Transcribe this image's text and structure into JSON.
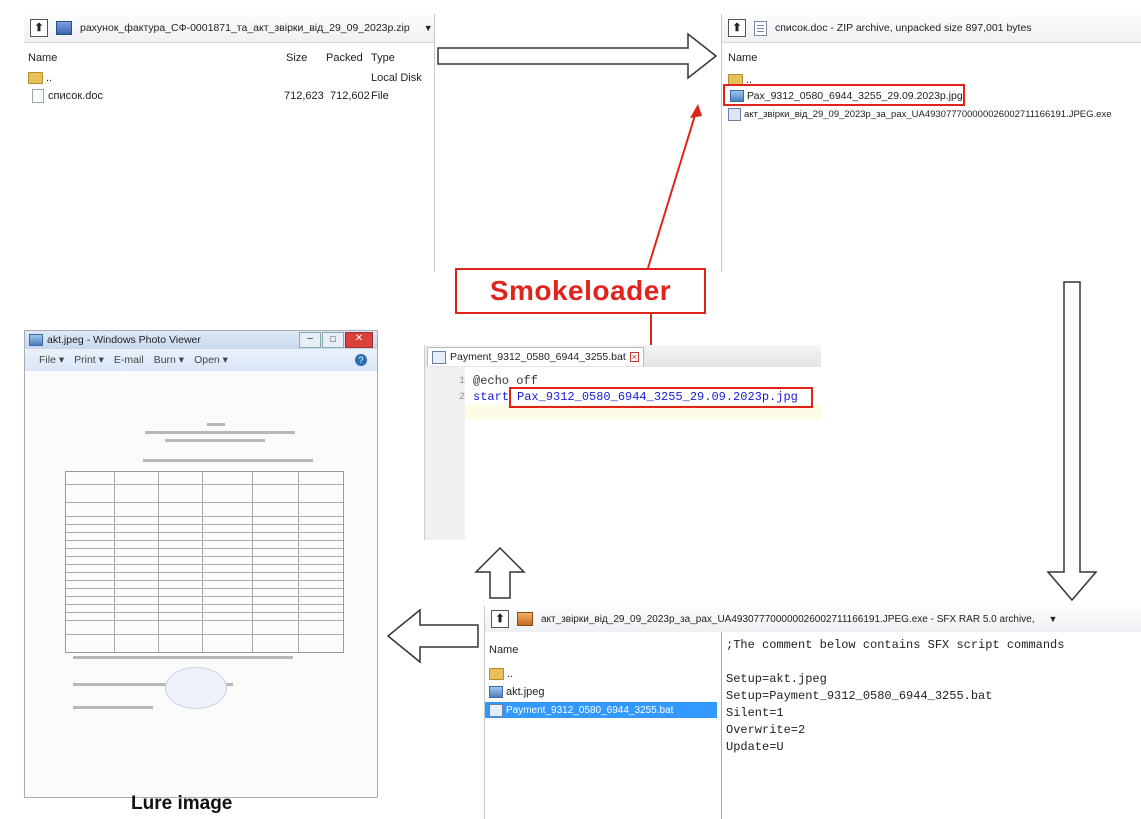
{
  "top_left_panel": {
    "path": "рахунок_фактура_СФ-0001871_та_акт_звірки_від_29_09_2023р.zip",
    "columns": [
      "Name",
      "Size",
      "Packed",
      "Type"
    ],
    "rows": [
      {
        "name": "..",
        "size": "",
        "packed": "",
        "type": "Local Disk"
      },
      {
        "name": "список.doc",
        "size": "712,623",
        "packed": "712,602",
        "type": "File"
      }
    ]
  },
  "top_right_panel": {
    "path": "список.doc - ZIP archive, unpacked size 897,001 bytes",
    "column": "Name",
    "rows": [
      {
        "name": ".."
      },
      {
        "name": "Рах_9312_0580_6944_3255_29.09.2023р.jpg"
      },
      {
        "name": "акт_звірки_від_29_09_2023р_за_рах_UA493077700000026002711166191.JPEG.exe"
      }
    ]
  },
  "label": "Smokeloader",
  "editor": {
    "tab": "Payment_9312_0580_6944_3255.bat",
    "lines": [
      {
        "num": "1",
        "kw": "@echo off",
        "rest": ""
      },
      {
        "num": "2",
        "kw": "start",
        "rest": "Рах_9312_0580_6944_3255_29.09.2023р.jpg"
      }
    ]
  },
  "photo_viewer": {
    "title": "akt.jpeg - Windows Photo Viewer",
    "menu": [
      "File",
      "Print",
      "E-mail",
      "Burn",
      "Open"
    ]
  },
  "sfx_panel": {
    "path": "акт_звірки_від_29_09_2023р_за_рах_UA493077700000026002711166191.JPEG.exe - SFX RAR 5.0 archive,",
    "column": "Name",
    "rows": [
      {
        "name": ".."
      },
      {
        "name": "akt.jpeg"
      },
      {
        "name": "Payment_9312_0580_6944_3255.bat"
      }
    ],
    "script_lines": [
      ";The comment below contains SFX script commands",
      "",
      "Setup=akt.jpeg",
      "Setup=Payment_9312_0580_6944_3255.bat",
      "Silent=1",
      "Overwrite=2",
      "Update=U"
    ]
  },
  "lure_caption": "Lure image",
  "colors": {
    "highlight_red": "#e0241c",
    "selection_blue": "#3399ff",
    "keyword_blue": "#1a1ad6"
  }
}
